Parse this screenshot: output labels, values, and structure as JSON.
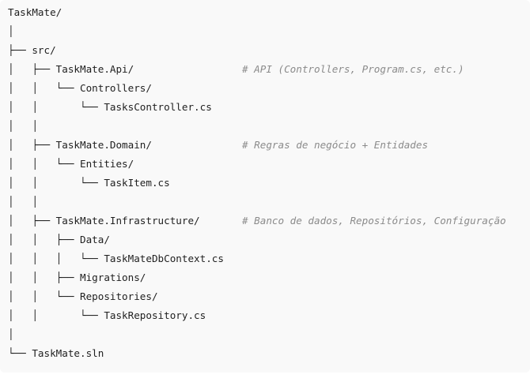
{
  "code_block": {
    "language": "plaintext",
    "lines": [
      {
        "text": "TaskMate/",
        "comment": ""
      },
      {
        "text": "│",
        "comment": ""
      },
      {
        "text": "├── src/",
        "comment": ""
      },
      {
        "text": "│   ├── TaskMate.Api/",
        "comment": "# API (Controllers, Program.cs, etc.)"
      },
      {
        "text": "│   │   └── Controllers/",
        "comment": ""
      },
      {
        "text": "│   │       └── TasksController.cs",
        "comment": ""
      },
      {
        "text": "│   │",
        "comment": ""
      },
      {
        "text": "│   ├── TaskMate.Domain/",
        "comment": "# Regras de negócio + Entidades"
      },
      {
        "text": "│   │   └── Entities/",
        "comment": ""
      },
      {
        "text": "│   │       └── TaskItem.cs",
        "comment": ""
      },
      {
        "text": "│   │",
        "comment": ""
      },
      {
        "text": "│   ├── TaskMate.Infrastructure/",
        "comment": "# Banco de dados, Repositórios, Configuração"
      },
      {
        "text": "│   │   ├── Data/",
        "comment": ""
      },
      {
        "text": "│   │   │   └── TaskMateDbContext.cs",
        "comment": ""
      },
      {
        "text": "│   │   ├── Migrations/",
        "comment": ""
      },
      {
        "text": "│   │   └── Repositories/",
        "comment": ""
      },
      {
        "text": "│   │       └── TaskRepository.cs",
        "comment": ""
      },
      {
        "text": "│",
        "comment": ""
      },
      {
        "text": "└── TaskMate.sln",
        "comment": ""
      }
    ]
  },
  "colors": {
    "background": "#f9f9f9",
    "text": "#1f1f1f",
    "comment": "#8b8b8b"
  }
}
